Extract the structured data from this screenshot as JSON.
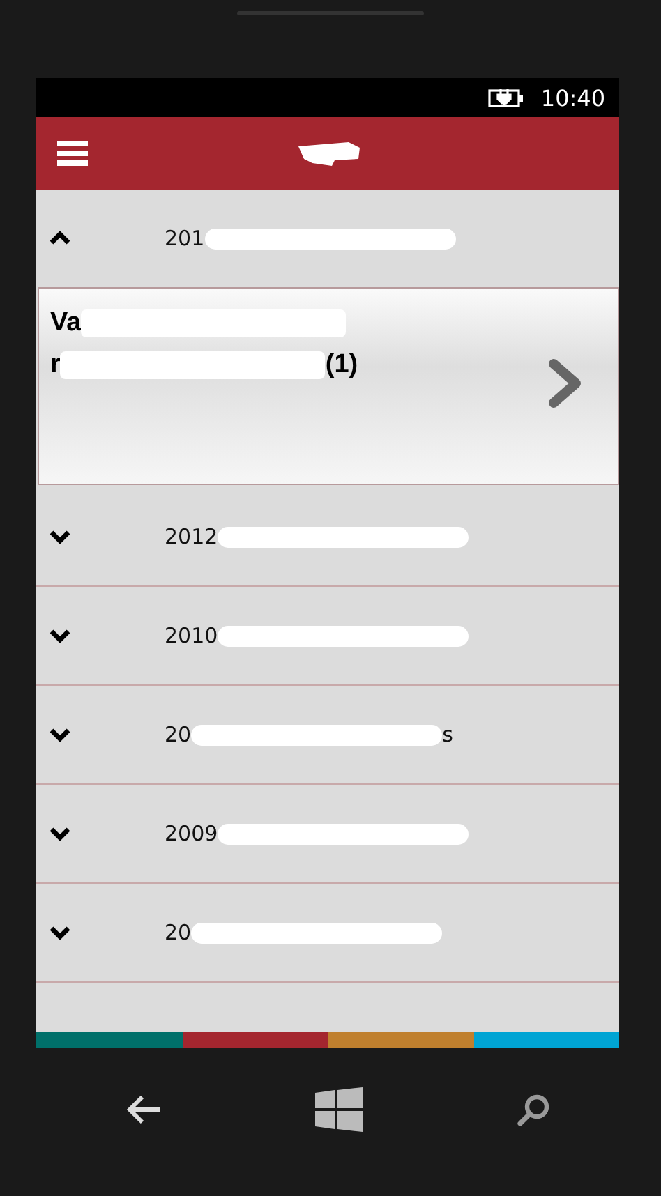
{
  "status_bar": {
    "time": "10:40",
    "charging": true
  },
  "sections": [
    {
      "title_start": "201",
      "expanded": true,
      "items": [
        {
          "lines": [
            {
              "start": "Va"
            },
            {
              "start": "r",
              "end": "(1)"
            }
          ]
        }
      ]
    },
    {
      "title_start": "2012",
      "expanded": false
    },
    {
      "title_start": "2010",
      "expanded": false
    },
    {
      "title_start": "20",
      "title_end": "s",
      "expanded": false
    },
    {
      "title_start": "2009",
      "expanded": false
    },
    {
      "title_start": "20",
      "expanded": false
    }
  ],
  "color_strip": [
    {
      "color": "#00706a"
    },
    {
      "color": "#a4262f"
    },
    {
      "color": "#c0802e"
    },
    {
      "color": "#00a4d4"
    }
  ]
}
